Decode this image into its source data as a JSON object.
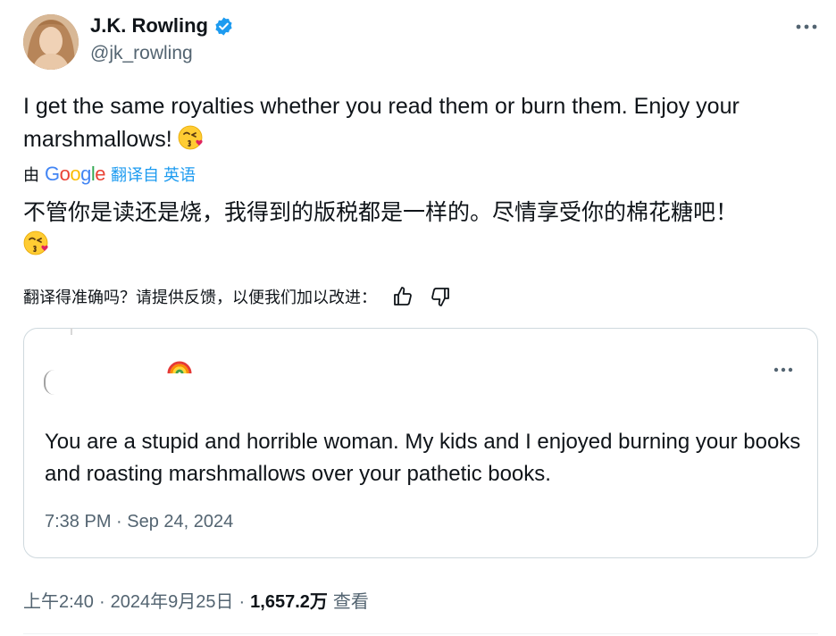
{
  "author": {
    "name": "J.K. Rowling",
    "handle": "@jk_rowling",
    "verified": true
  },
  "tweet": {
    "text_line1": "I get the same royalties whether you read them or burn them. Enjoy your",
    "text_line2": "marshmallows!",
    "emoji": "kissing-face-with-heart-emoji"
  },
  "translation": {
    "by_label": "由",
    "provider": "Google",
    "translated_from_label": "翻译自 英语",
    "translated_text": "不管你是读还是烧，我得到的版税都是一样的。尽情享受你的棉花糖吧！"
  },
  "feedback": {
    "prompt": "翻译得准确吗？请提供反馈，以便我们加以改进：",
    "thumbs_up_icon": "thumbs-up-icon",
    "thumbs_down_icon": "thumbs-down-icon"
  },
  "quote": {
    "text": "You are a stupid and horrible woman. My kids and I enjoyed burning your books and roasting marshmallows over your pathetic books.",
    "timestamp": "7:38 PM · Sep 24, 2024",
    "emoji": "rainbow-emoji"
  },
  "meta": {
    "time": "上午2:40",
    "date": "2024年9月25日",
    "views_count": "1,657.2万",
    "views_label": "查看",
    "separator": "·"
  },
  "colors": {
    "text": "#0f1419",
    "secondary": "#536471",
    "link": "#1d9bf0",
    "border": "#cfd9de",
    "verified": "#1d9bf0"
  }
}
